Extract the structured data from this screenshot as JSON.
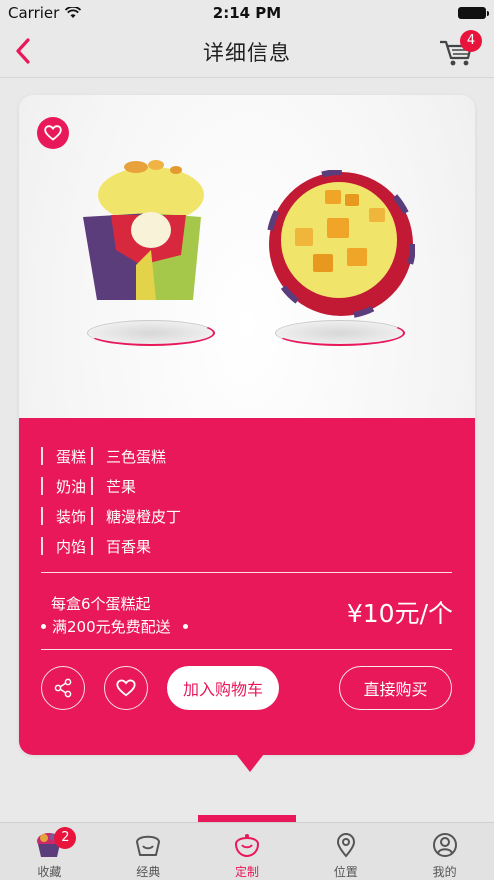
{
  "status_bar": {
    "carrier": "Carrier",
    "time": "2:14 PM"
  },
  "nav": {
    "title": "详细信息",
    "cart_count": "4"
  },
  "colors": {
    "accent": "#e8185a",
    "badge": "#e8143c",
    "background": "#e9e9e9"
  },
  "product": {
    "specs": [
      {
        "label": "蛋糕",
        "value": "三色蛋糕"
      },
      {
        "label": "奶油",
        "value": "芒果"
      },
      {
        "label": "装饰",
        "value": "糖漫橙皮丁"
      },
      {
        "label": "内馅",
        "value": "百香果"
      }
    ],
    "promo_line1": "每盒6个蛋糕起",
    "promo_line2": "满200元免费配送",
    "price": "¥10元/个",
    "add_to_cart_label": "加入购物车",
    "buy_now_label": "直接购买"
  },
  "tabs": [
    {
      "label": "收藏",
      "icon": "cupcake-icon",
      "badge": "2"
    },
    {
      "label": "经典",
      "icon": "classic-icon"
    },
    {
      "label": "定制",
      "icon": "custom-icon",
      "active": true
    },
    {
      "label": "位置",
      "icon": "location-icon"
    },
    {
      "label": "我的",
      "icon": "profile-icon"
    }
  ]
}
